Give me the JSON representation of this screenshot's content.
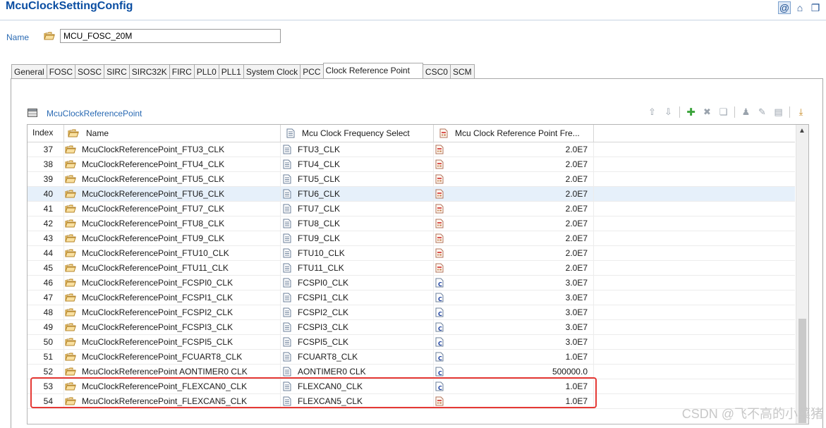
{
  "app": {
    "title": "McuClockSettingConfig"
  },
  "top_icons": [
    "at-icon",
    "home-icon",
    "restore-window-icon"
  ],
  "name_field": {
    "label": "Name",
    "value": "MCU_FOSC_20M"
  },
  "tabs": [
    {
      "label": "General"
    },
    {
      "label": "FOSC"
    },
    {
      "label": "SOSC"
    },
    {
      "label": "SIRC"
    },
    {
      "label": "SIRC32K"
    },
    {
      "label": "FIRC"
    },
    {
      "label": "PLL0"
    },
    {
      "label": "PLL1"
    },
    {
      "label": "System Clock"
    },
    {
      "label": "PCC"
    },
    {
      "label": "Clock Reference Point",
      "active": true
    },
    {
      "label": "CSC0"
    },
    {
      "label": "SCM"
    }
  ],
  "section": {
    "title": "McuClockReferencePoint"
  },
  "table": {
    "headers": {
      "index": "Index",
      "name": "Name",
      "freq_select": "Mcu Clock Frequency Select",
      "ref_freq": "Mcu Clock Reference Point Fre..."
    },
    "rows": [
      {
        "index": "37",
        "name": "McuClockReferencePoint_FTU3_CLK",
        "freq": "FTU3_CLK",
        "value": "2.0E7",
        "icon": "calc"
      },
      {
        "index": "38",
        "name": "McuClockReferencePoint_FTU4_CLK",
        "freq": "FTU4_CLK",
        "value": "2.0E7",
        "icon": "calc"
      },
      {
        "index": "39",
        "name": "McuClockReferencePoint_FTU5_CLK",
        "freq": "FTU5_CLK",
        "value": "2.0E7",
        "icon": "calc"
      },
      {
        "index": "40",
        "name": "McuClockReferencePoint_FTU6_CLK",
        "freq": "FTU6_CLK",
        "value": "2.0E7",
        "icon": "calc",
        "selected": true
      },
      {
        "index": "41",
        "name": "McuClockReferencePoint_FTU7_CLK",
        "freq": "FTU7_CLK",
        "value": "2.0E7",
        "icon": "calc"
      },
      {
        "index": "42",
        "name": "McuClockReferencePoint_FTU8_CLK",
        "freq": "FTU8_CLK",
        "value": "2.0E7",
        "icon": "calc"
      },
      {
        "index": "43",
        "name": "McuClockReferencePoint_FTU9_CLK",
        "freq": "FTU9_CLK",
        "value": "2.0E7",
        "icon": "calc"
      },
      {
        "index": "44",
        "name": "McuClockReferencePoint_FTU10_CLK",
        "freq": "FTU10_CLK",
        "value": "2.0E7",
        "icon": "calc"
      },
      {
        "index": "45",
        "name": "McuClockReferencePoint_FTU11_CLK",
        "freq": "FTU11_CLK",
        "value": "2.0E7",
        "icon": "calc"
      },
      {
        "index": "46",
        "name": "McuClockReferencePoint_FCSPI0_CLK",
        "freq": "FCSPI0_CLK",
        "value": "3.0E7",
        "icon": "config"
      },
      {
        "index": "47",
        "name": "McuClockReferencePoint_FCSPI1_CLK",
        "freq": "FCSPI1_CLK",
        "value": "3.0E7",
        "icon": "config"
      },
      {
        "index": "48",
        "name": "McuClockReferencePoint_FCSPI2_CLK",
        "freq": "FCSPI2_CLK",
        "value": "3.0E7",
        "icon": "config"
      },
      {
        "index": "49",
        "name": "McuClockReferencePoint_FCSPI3_CLK",
        "freq": "FCSPI3_CLK",
        "value": "3.0E7",
        "icon": "config"
      },
      {
        "index": "50",
        "name": "McuClockReferencePoint_FCSPI5_CLK",
        "freq": "FCSPI5_CLK",
        "value": "3.0E7",
        "icon": "config"
      },
      {
        "index": "51",
        "name": "McuClockReferencePoint_FCUART8_CLK",
        "freq": "FCUART8_CLK",
        "value": "1.0E7",
        "icon": "config"
      },
      {
        "index": "52",
        "name": "McuClockReferencePoint AONTIMER0 CLK",
        "freq": "AONTIMER0 CLK",
        "value": "500000.0",
        "icon": "config"
      },
      {
        "index": "53",
        "name": "McuClockReferencePoint_FLEXCAN0_CLK",
        "freq": "FLEXCAN0_CLK",
        "value": "1.0E7",
        "icon": "config"
      },
      {
        "index": "54",
        "name": "McuClockReferencePoint_FLEXCAN5_CLK",
        "freq": "FLEXCAN5_CLK",
        "value": "1.0E7",
        "icon": "calc"
      }
    ]
  },
  "watermark": "CSDN @飞不高的小菜猪",
  "colors": {
    "title": "#0b4ea2",
    "link": "#2a6ab3",
    "highlight": "#e53935",
    "selected_row": "#e6f0fa"
  }
}
